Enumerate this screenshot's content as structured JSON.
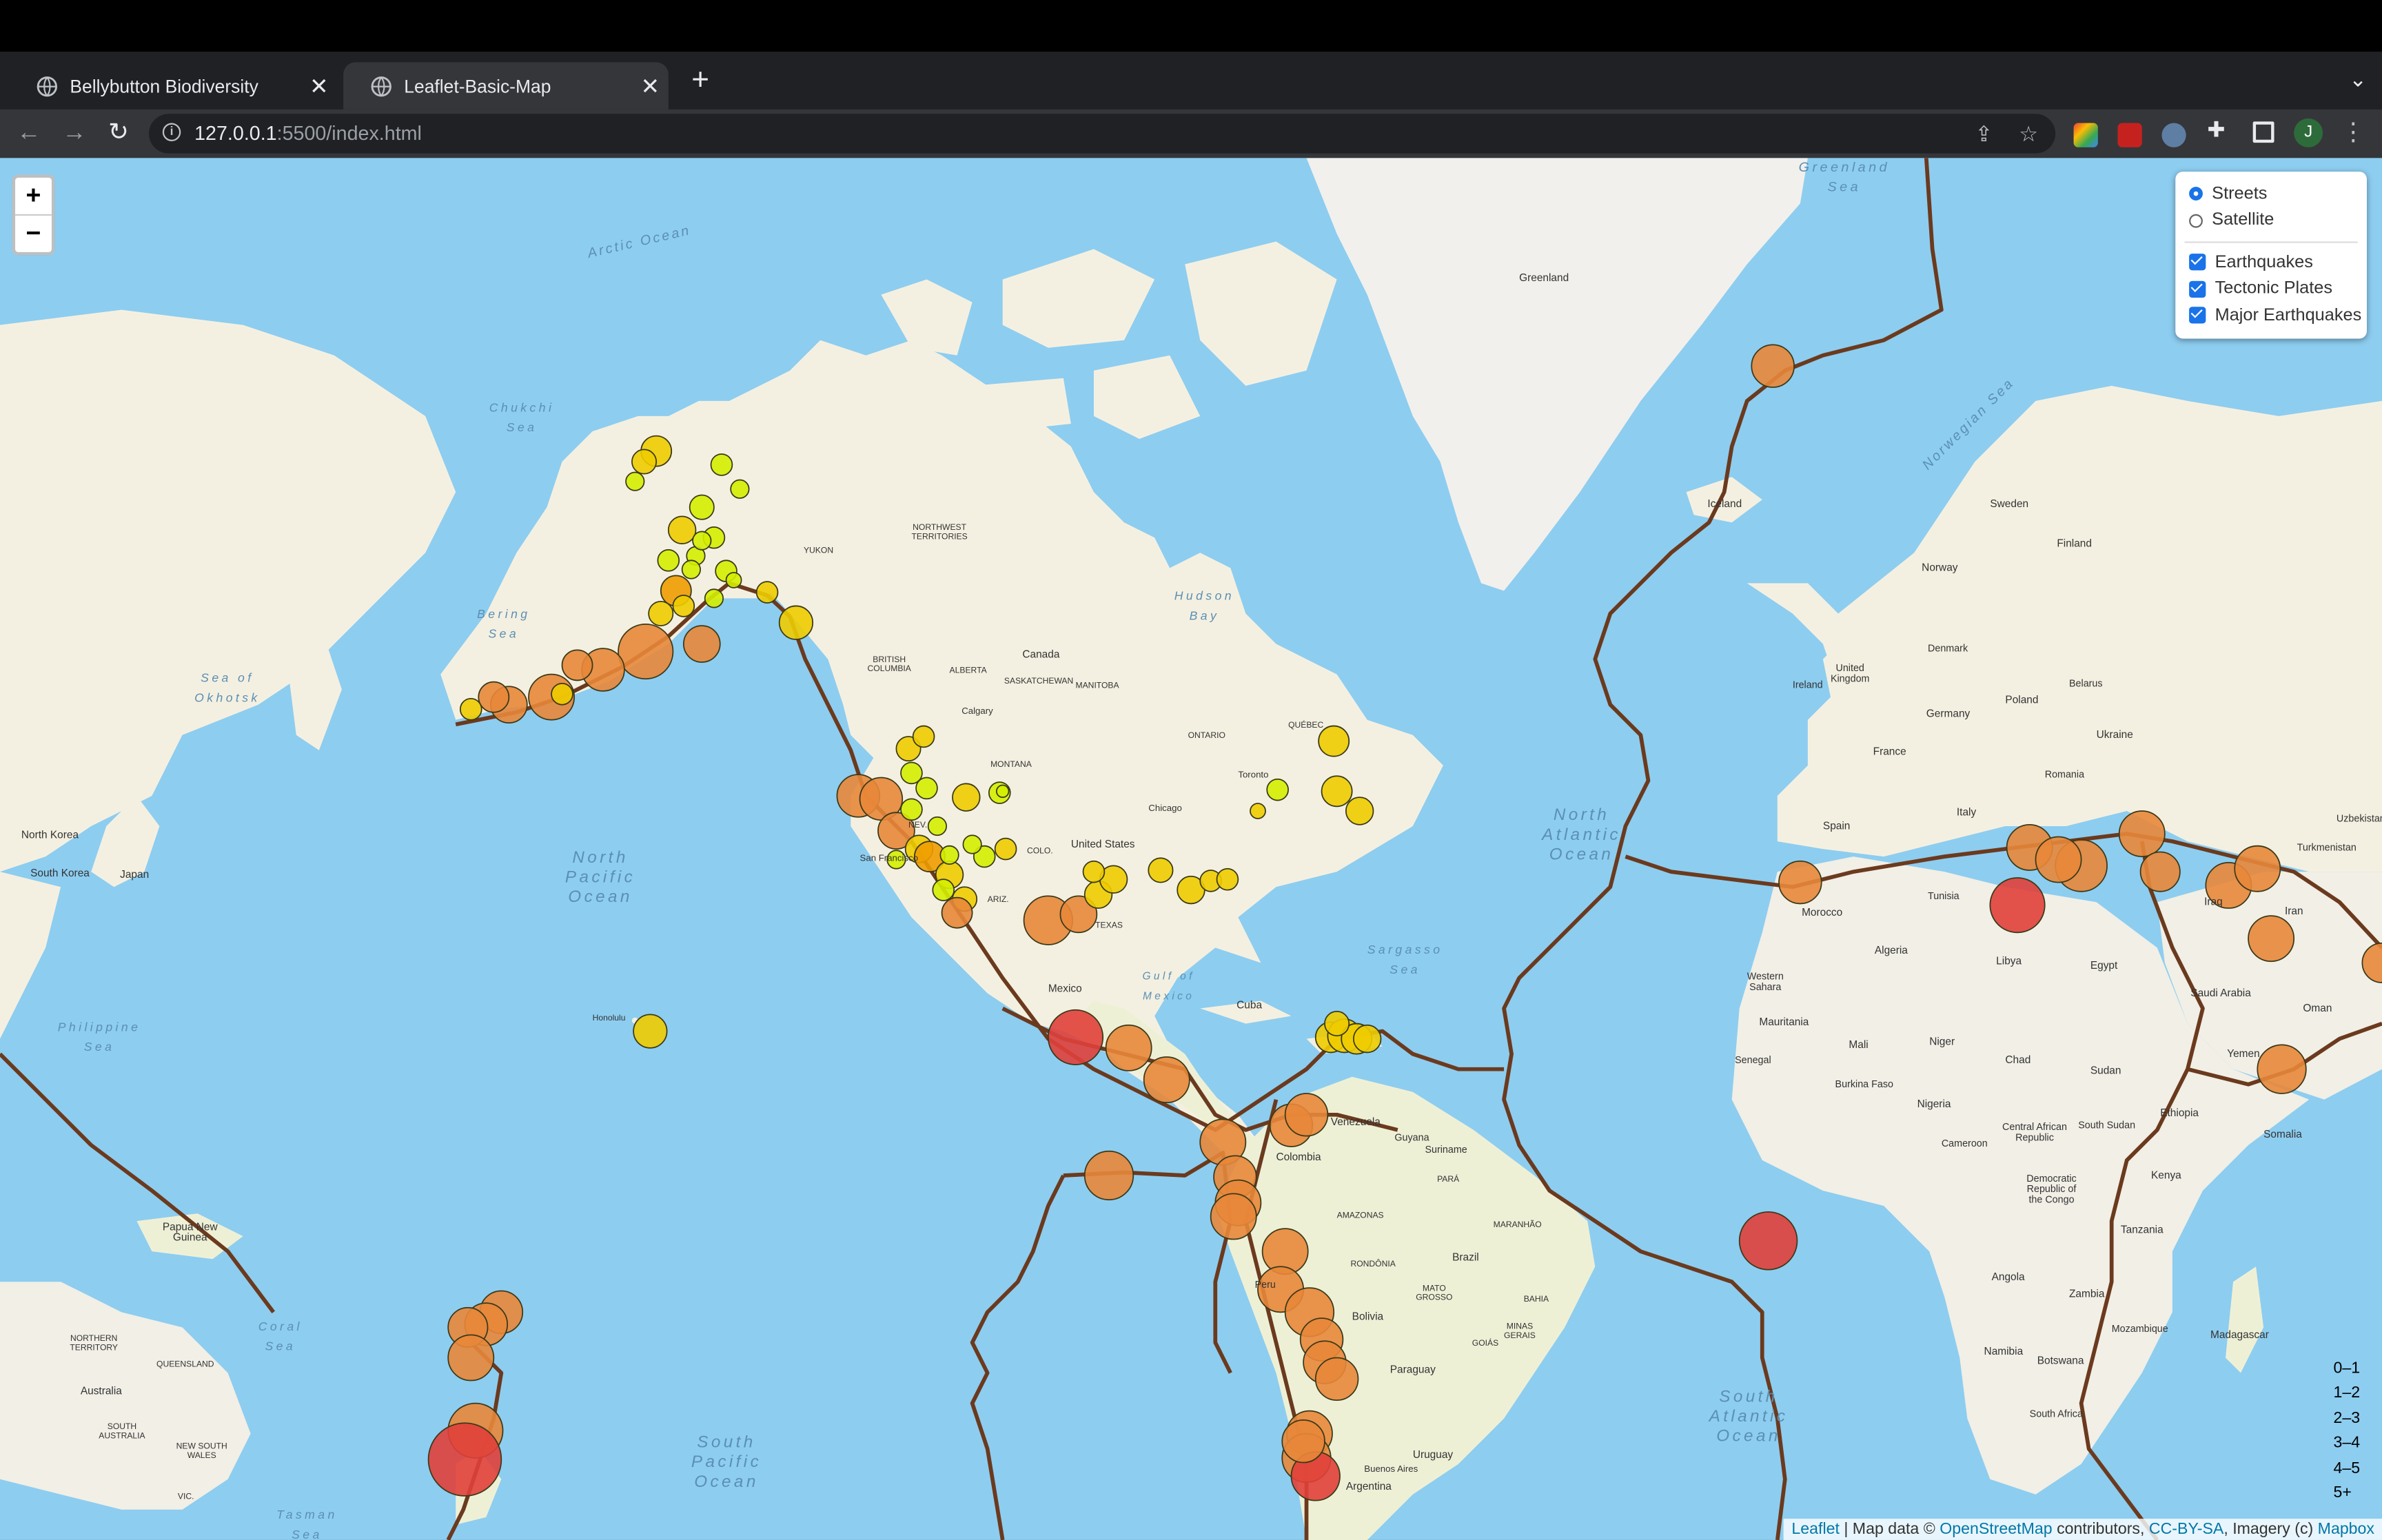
{
  "browser": {
    "tabs": [
      {
        "title": "Bellybutton Biodiversity",
        "active": false
      },
      {
        "title": "Leaflet-Basic-Map",
        "active": true
      }
    ],
    "url_host": "127.0.0.1",
    "url_rest": ":5500/index.html",
    "profile_initial": "J"
  },
  "map": {
    "zoom_in": "+",
    "zoom_out": "−",
    "base_layers": [
      {
        "label": "Streets",
        "selected": true
      },
      {
        "label": "Satellite",
        "selected": false
      }
    ],
    "overlays": [
      {
        "label": "Earthquakes",
        "checked": true
      },
      {
        "label": "Tectonic Plates",
        "checked": true
      },
      {
        "label": "Major Earthquakes",
        "checked": true
      }
    ],
    "legend": [
      {
        "label": "0–1",
        "color": "#98ee00"
      },
      {
        "label": "1–2",
        "color": "#d4ee00"
      },
      {
        "label": "2–3",
        "color": "#eecc00"
      },
      {
        "label": "3–4",
        "color": "#ee9c00"
      },
      {
        "label": "4–5",
        "color": "#ea822c"
      },
      {
        "label": "5+",
        "color": "#ea2c2c"
      }
    ],
    "attribution": {
      "leaflet": "Leaflet",
      "sep1": " | Map data © ",
      "osm": "OpenStreetMap",
      "contrib": " contributors, ",
      "license": "CC-BY-SA",
      "imagery": ", Imagery (c) ",
      "mapbox": "Mapbox"
    },
    "labels": {
      "arctic": "Arctic Ocean",
      "north_pacific": "North\nPacific\nOcean",
      "south_pacific": "South\nPacific\nOcean",
      "north_atlantic": "North\nAtlantic\nOcean",
      "south_atlantic": "South\nAtlantic\nOcean",
      "greenland": "Greenland",
      "greenland_sea": "Greenland\nSea",
      "norwegian_sea": "Norwegian Sea",
      "bering": "Bering\nSea",
      "chukchi": "Chukchi\nSea",
      "sea_okhotsk": "Sea of\nOkhotsk",
      "philippine": "Philippine\nSea",
      "coral": "Coral\nSea",
      "tasman": "Tasman\nSea",
      "sargasso": "Sargasso\nSea",
      "canada": "Canada",
      "united_states": "United States",
      "mexico": "Mexico",
      "cuba": "Cuba",
      "venezuela": "Venezuela",
      "colombia": "Colombia",
      "brazil": "Brazil",
      "bolivia": "Bolivia",
      "paraguay": "Paraguay",
      "argentina": "Argentina",
      "uruguay": "Uruguay",
      "peru": "Peru",
      "iceland": "Iceland",
      "sweden": "Sweden",
      "finland": "Finland",
      "norway": "Norway",
      "germany": "Germany",
      "poland": "Poland",
      "ukraine": "Ukraine",
      "france": "France",
      "spain": "Spain",
      "italy": "Italy",
      "libya": "Libya",
      "algeria": "Algeria",
      "egypt": "Egypt",
      "morocco": "Morocco",
      "mali": "Mali",
      "niger": "Niger",
      "chad": "Chad",
      "sudan": "Sudan",
      "nigeria": "Nigeria",
      "mauritania": "Mauritania",
      "ethiopia": "Ethiopia",
      "kenya": "Kenya",
      "tanzania": "Tanzania",
      "angola": "Angola",
      "namibia": "Namibia",
      "zambia": "Zambia",
      "botswana": "Botswana",
      "madagascar": "Madagascar",
      "saudi": "Saudi Arabia",
      "iran": "Iran",
      "iraq": "Iraq",
      "yemen": "Yemen",
      "oman": "Oman",
      "somalia": "Somalia",
      "australia": "Australia",
      "japan": "Japan",
      "north_korea": "North Korea",
      "south_korea": "South Korea",
      "png": "Papua New\nGuinea",
      "yukon": "YUKON",
      "nwt": "NORTHWEST\nTERRITORIES",
      "bc": "BRITISH\nCOLUMBIA",
      "alberta": "ALBERTA",
      "saskatchewan": "SASKATCHEWAN",
      "manitoba": "MANITOBA",
      "ontario": "ONTARIO",
      "quebec": "QUÉBEC",
      "hudson_bay": "Hudson\nBay",
      "gulf_mexico": "Gulf of\nMexico",
      "honolulu": "Honolulu",
      "uzbekistan": "Uzbekistan",
      "turkmenistan": "Turkmenistan",
      "belarus": "Belarus",
      "romania": "Romania",
      "mozambique": "Mozambique",
      "tunisia": "Tunisia",
      "denmark": "Denmark",
      "ireland": "Ireland",
      "uk": "United\nKingdom",
      "guyana": "Guyana",
      "suriname": "Suriname",
      "amazonas": "AMAZONAS",
      "mato_grosso": "MATO\nGROSSO",
      "bahia": "BAHIA",
      "para": "PARÁ",
      "goias": "GOIÁS",
      "minas": "MINAS\nGERAIS",
      "rondonia": "RONDÔNIA",
      "maranhao": "MARANHÃO",
      "montana": "MONTANA",
      "texas": "TEXAS",
      "colo": "COLO.",
      "nev": "NEV.",
      "ariz": "ARIZ.",
      "new_south_wales": "NEW SOUTH\nWALES",
      "queensland": "QUEENSLAND",
      "northern_territory": "NORTHERN\nTERRITORY",
      "south_australia": "SOUTH\nAUSTRALIA",
      "vic": "VIC.",
      "sahara": "Western\nSahara",
      "senegal": "Senegal",
      "south_africa": "South Africa",
      "drc": "Democratic\nRepublic of\nthe Congo",
      "cameroon": "Cameroon",
      "central_african": "Central African\nRepublic",
      "south_sudan": "South Sudan",
      "burkina": "Burkina Faso",
      "chicago": "Chicago",
      "san_francisco": "San Francisco",
      "toronto": "Toronto",
      "buenos_aires": "Buenos Aires",
      "calgary": "Calgary"
    }
  }
}
